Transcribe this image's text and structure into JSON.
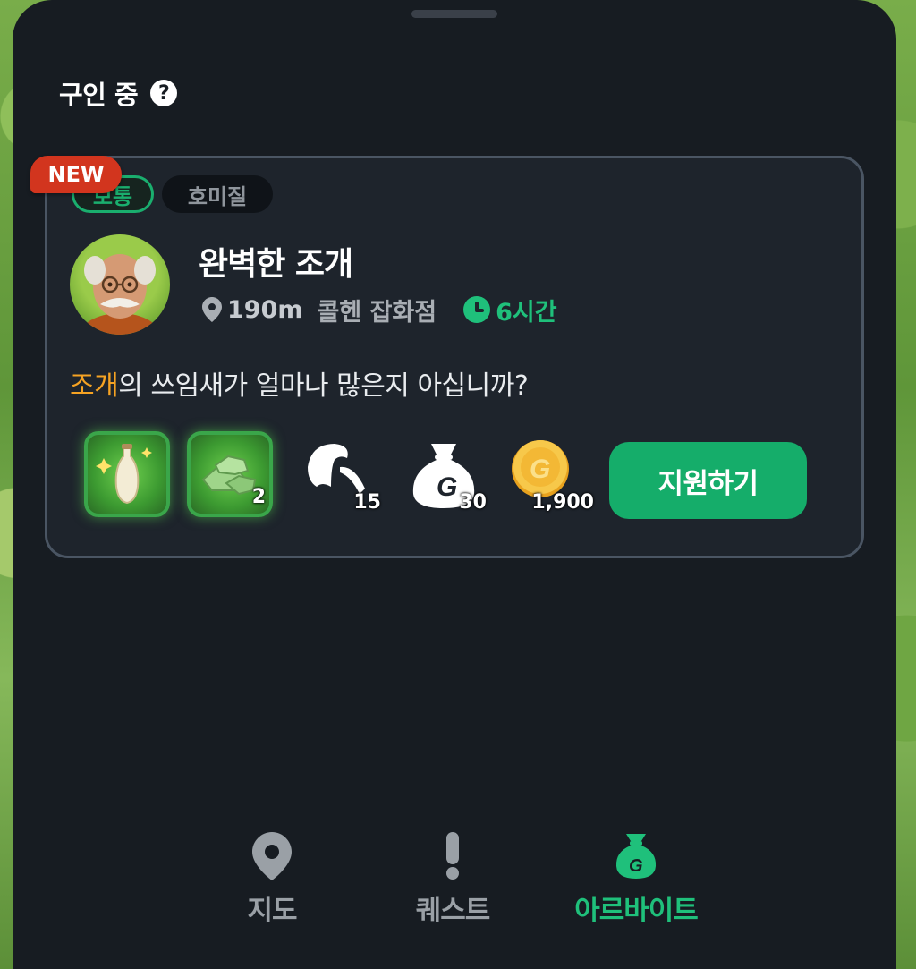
{
  "section": {
    "title": "구인 중",
    "help_icon": "question-circle-icon"
  },
  "job": {
    "badge_new": "NEW",
    "tags": [
      "보통",
      "호미질"
    ],
    "title": "완벽한 조개",
    "distance": "190m",
    "shop": "콜헨 잡화점",
    "duration": "6시간",
    "desc_highlight": "조개",
    "desc_rest": "의 쓰임새가 얼마나 많은지 아십니까?",
    "rewards": [
      {
        "icon": "potion-icon",
        "count": ""
      },
      {
        "icon": "ore-icon",
        "count": "2"
      },
      {
        "icon": "feather-icon",
        "count": "15"
      },
      {
        "icon": "money-bag-icon",
        "count": "30"
      },
      {
        "icon": "gold-coin-icon",
        "count": "1,900"
      }
    ],
    "apply_label": "지원하기"
  },
  "nav": {
    "items": [
      {
        "label": "지도",
        "icon": "map-pin-icon",
        "active": false
      },
      {
        "label": "퀘스트",
        "icon": "exclamation-icon",
        "active": false
      },
      {
        "label": "아르바이트",
        "icon": "money-bag-icon",
        "active": true
      }
    ]
  },
  "colors": {
    "accent": "#15ad6a",
    "highlight": "#f6a323",
    "new_badge": "#d2351e",
    "sheet_bg": "#171c22"
  }
}
